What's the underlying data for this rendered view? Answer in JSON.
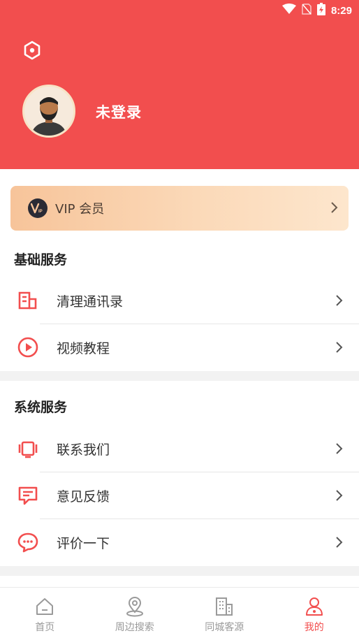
{
  "status_bar": {
    "time": "8:29"
  },
  "profile": {
    "username": "未登录"
  },
  "vip": {
    "label": "VIP 会员"
  },
  "basic_services": {
    "title": "基础服务",
    "items": [
      {
        "label": "清理通讯录",
        "icon": "contacts-clean-icon"
      },
      {
        "label": "视频教程",
        "icon": "play-icon"
      }
    ]
  },
  "system_services": {
    "title": "系统服务",
    "items": [
      {
        "label": "联系我们",
        "icon": "phone-icon"
      },
      {
        "label": "意见反馈",
        "icon": "feedback-icon"
      },
      {
        "label": "评价一下",
        "icon": "chat-bubble-icon"
      }
    ]
  },
  "tabbar": {
    "items": [
      {
        "label": "首页",
        "icon": "home-icon"
      },
      {
        "label": "周边搜索",
        "icon": "location-pin-icon"
      },
      {
        "label": "同城客源",
        "icon": "building-icon"
      },
      {
        "label": "我的",
        "icon": "user-icon",
        "active": true
      }
    ]
  },
  "colors": {
    "accent": "#f24e4e",
    "tab_inactive": "#9a9a9a"
  }
}
